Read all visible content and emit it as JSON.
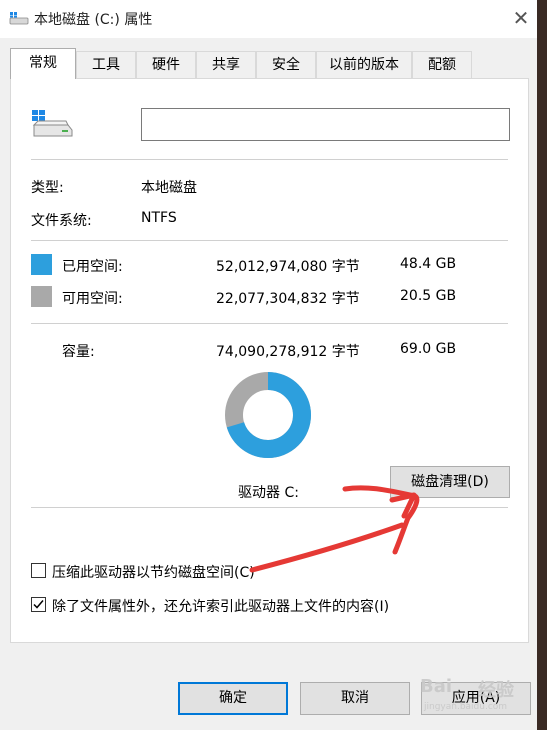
{
  "window": {
    "title": "本地磁盘 (C:) 属性",
    "close_glyph": "✕"
  },
  "tabs": [
    {
      "label": "常规",
      "active": true
    },
    {
      "label": "工具",
      "active": false
    },
    {
      "label": "硬件",
      "active": false
    },
    {
      "label": "共享",
      "active": false
    },
    {
      "label": "安全",
      "active": false
    },
    {
      "label": "以前的版本",
      "active": false
    },
    {
      "label": "配额",
      "active": false
    }
  ],
  "general": {
    "name_value": "",
    "type_label": "类型:",
    "type_value": "本地磁盘",
    "fs_label": "文件系统:",
    "fs_value": "NTFS",
    "used": {
      "label": "已用空间:",
      "bytes": "52,012,974,080 字节",
      "size": "48.4 GB",
      "color": "#2d9fdd"
    },
    "free": {
      "label": "可用空间:",
      "bytes": "22,077,304,832 字节",
      "size": "20.5 GB",
      "color": "#a9a9a9"
    },
    "capacity": {
      "label": "容量:",
      "bytes": "74,090,278,912 字节",
      "size": "69.0 GB"
    },
    "used_fraction": 0.702,
    "drive_label": "驱动器 C:",
    "cleanup_button": "磁盘清理(D)",
    "compress_checkbox": {
      "label": "压缩此驱动器以节约磁盘空间(C)",
      "checked": false
    },
    "index_checkbox": {
      "label": "除了文件属性外，还允许索引此驱动器上文件的内容(I)",
      "checked": true
    }
  },
  "buttons": {
    "ok": "确定",
    "cancel": "取消",
    "apply": "应用(A)"
  },
  "watermark": {
    "brand": "Bai",
    "brand2": "经验",
    "sub": "jingyan.baidu.com"
  },
  "icons": [
    "drive-icon",
    "close-icon",
    "checkmark-icon"
  ]
}
